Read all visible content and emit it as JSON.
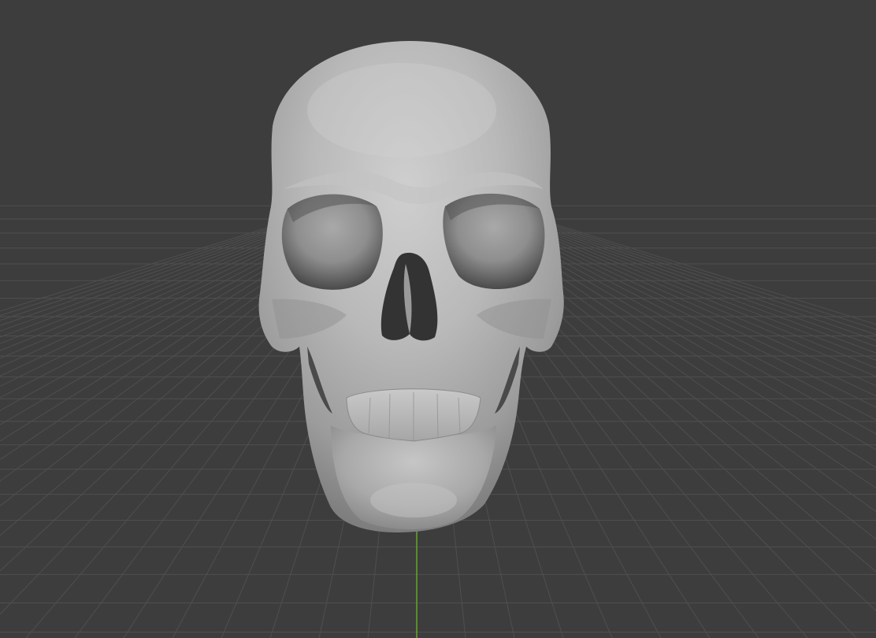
{
  "viewport": {
    "background_color": "#3d3d3d",
    "grid_line_color": "#4f4f4f",
    "y_axis_color": "#6aa23a"
  },
  "object": {
    "type": "skull-mesh",
    "shading": "solid-gray",
    "base_color": "#a8a8a8"
  }
}
